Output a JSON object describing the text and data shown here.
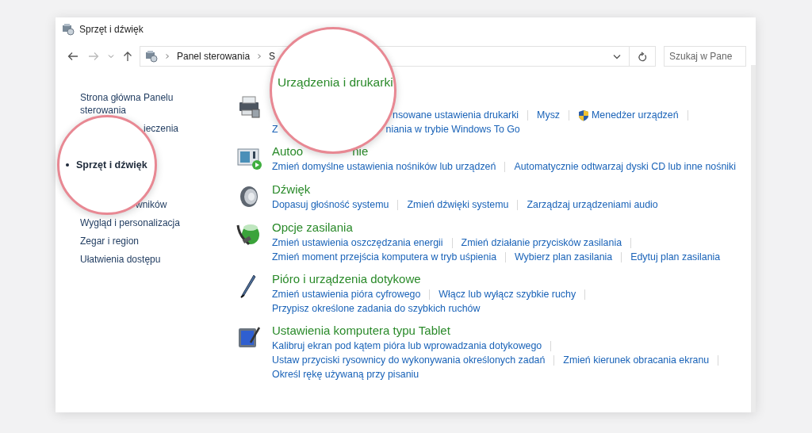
{
  "window": {
    "title": "Sprzęt i dźwięk"
  },
  "address_bar": {
    "crumbs": [
      "Panel sterowania",
      "S"
    ]
  },
  "search": {
    "placeholder": "Szukaj w Pane"
  },
  "sidebar": {
    "items": [
      {
        "text": "Strona główna Panelu sterowania",
        "kind": "full",
        "selected": false
      },
      {
        "text": "ieczenia",
        "kind": "cut",
        "selected": false
      },
      {
        "text": "wników",
        "kind": "cut",
        "selected": false
      },
      {
        "text": "Wygląd i personalizacja",
        "kind": "full",
        "selected": false
      },
      {
        "text": "Zegar i region",
        "kind": "full",
        "selected": false
      },
      {
        "text": "Ułatwienia dostępu",
        "kind": "full",
        "selected": false
      }
    ]
  },
  "sections": [
    {
      "lines": [
        [
          {
            "text": "nsowane ustawienia drukarki",
            "kind": "cut"
          },
          {
            "text": "Mysz",
            "kind": "link"
          },
          {
            "text": "Menedżer urządzeń",
            "kind": "shield"
          }
        ],
        [
          {
            "text": "Z",
            "kind": "link"
          },
          {
            "text": "niania w trybie Windows To Go",
            "kind": "cut"
          }
        ]
      ]
    },
    {
      "title_parts": [
        {
          "text": "Autoo",
          "kind": "full"
        },
        {
          "text": "nie",
          "kind": "cut"
        }
      ],
      "lines": [
        [
          {
            "text": "Zmień domyślne ustawienia nośników lub urządzeń",
            "kind": "link"
          },
          {
            "text": "Automatycznie odtwarzaj dyski CD lub inne nośniki",
            "kind": "link"
          }
        ]
      ]
    },
    {
      "title_parts": [
        {
          "text": "Dźwięk",
          "kind": "full"
        }
      ],
      "lines": [
        [
          {
            "text": "Dopasuj głośność systemu",
            "kind": "link"
          },
          {
            "text": "Zmień dźwięki systemu",
            "kind": "link"
          },
          {
            "text": "Zarządzaj urządzeniami audio",
            "kind": "link"
          }
        ]
      ]
    },
    {
      "title_parts": [
        {
          "text": "Opcje zasilania",
          "kind": "full"
        }
      ],
      "lines": [
        [
          {
            "text": "Zmień ustawienia oszczędzania energii",
            "kind": "link"
          },
          {
            "text": "Zmień działanie przycisków zasilania",
            "kind": "link"
          }
        ],
        [
          {
            "text": "Zmień moment przejścia komputera w tryb uśpienia",
            "kind": "link"
          },
          {
            "text": "Wybierz plan zasilania",
            "kind": "link"
          },
          {
            "text": "Edytuj plan zasilania",
            "kind": "link"
          }
        ]
      ]
    },
    {
      "title_parts": [
        {
          "text": "Pióro i urządzenia dotykowe",
          "kind": "full"
        }
      ],
      "lines": [
        [
          {
            "text": "Zmień ustawienia pióra cyfrowego",
            "kind": "link"
          },
          {
            "text": "Włącz lub wyłącz szybkie ruchy",
            "kind": "link"
          }
        ],
        [
          {
            "text": "Przypisz określone zadania do szybkich ruchów",
            "kind": "link"
          }
        ]
      ]
    },
    {
      "title_parts": [
        {
          "text": "Ustawienia komputera typu Tablet",
          "kind": "full"
        }
      ],
      "lines": [
        [
          {
            "text": "Kalibruj ekran pod kątem pióra lub wprowadzania dotykowego",
            "kind": "link"
          }
        ],
        [
          {
            "text": "Ustaw przyciski rysownicy do wykonywania określonych zadań",
            "kind": "link"
          },
          {
            "text": "Zmień kierunek obracania ekranu",
            "kind": "link"
          }
        ],
        [
          {
            "text": "Określ rękę używaną przy pisaniu",
            "kind": "link"
          }
        ]
      ]
    }
  ],
  "magnifiers": [
    {
      "kind": "heading",
      "text": "Urządzenia i drukarki"
    },
    {
      "kind": "nav",
      "text": "Sprzęt i dźwięk",
      "selected": true
    }
  ]
}
